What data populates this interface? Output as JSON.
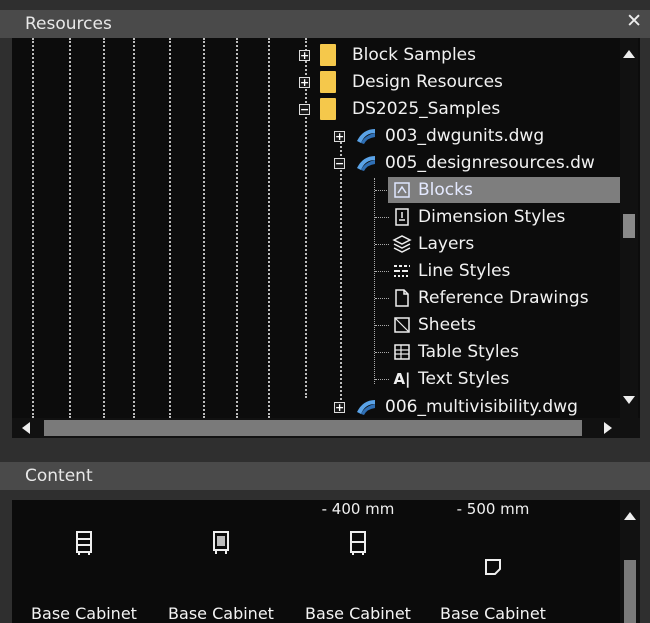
{
  "resources_panel": {
    "title": "Resources",
    "close_glyph": "✕",
    "tree": [
      {
        "label": "Block Samples",
        "icon": "folder-icon"
      },
      {
        "label": "Design Resources",
        "icon": "folder-icon"
      },
      {
        "label": "DS2025_Samples",
        "icon": "folder-icon"
      },
      {
        "label": "003_dwgunits.dwg",
        "icon": "dwg-file-icon"
      },
      {
        "label": "005_designresources.dw",
        "icon": "dwg-file-icon"
      },
      {
        "label": "Blocks",
        "icon": "blocks-icon",
        "selected": true
      },
      {
        "label": "Dimension Styles",
        "icon": "dimension-styles-icon"
      },
      {
        "label": "Layers",
        "icon": "layers-icon"
      },
      {
        "label": "Line Styles",
        "icon": "line-styles-icon"
      },
      {
        "label": "Reference Drawings",
        "icon": "reference-drawings-icon"
      },
      {
        "label": "Sheets",
        "icon": "sheets-icon"
      },
      {
        "label": "Table Styles",
        "icon": "table-styles-icon"
      },
      {
        "label": "Text Styles",
        "icon": "text-styles-icon"
      },
      {
        "label": "006_multivisibility.dwg",
        "icon": "dwg-file-icon"
      }
    ]
  },
  "content_panel": {
    "title": "Content",
    "items": [
      {
        "caption_top": "",
        "label": "Base Cabinet",
        "icon": "base-cabinet-icon"
      },
      {
        "caption_top": "",
        "label": "Base Cabinet",
        "icon": "base-cabinet-icon"
      },
      {
        "caption_top": "- 400 mm",
        "label": "Base Cabinet",
        "icon": "base-cabinet-icon"
      },
      {
        "caption_top": "- 500 mm",
        "label": "Base Cabinet",
        "icon": "base-cabinet-icon"
      }
    ]
  },
  "colors": {
    "folder": "#f5c84b",
    "selected_row": "#7e7e7e",
    "panel_bg": "#0c0c0c",
    "header_bg": "#4a4a4a"
  }
}
